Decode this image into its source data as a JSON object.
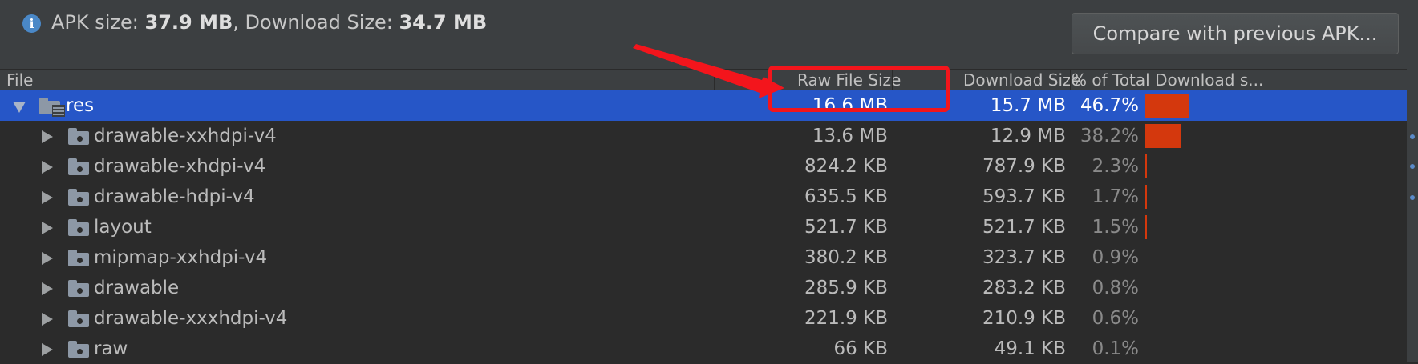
{
  "info": {
    "apk_label": "APK size: ",
    "apk_value": "37.9 MB",
    "separator": ", ",
    "download_label": "Download Size: ",
    "download_value": "34.7 MB"
  },
  "compare_button": "Compare with previous APK...",
  "columns": {
    "file": "File",
    "raw": "Raw File Size",
    "download": "Download Size",
    "percent": "% of Total Download s..."
  },
  "rows": [
    {
      "name": "res",
      "raw": "16.6 MB",
      "download": "15.7 MB",
      "percent": "46.7%",
      "pct_value": 46.7,
      "expanded": true,
      "selected": true
    },
    {
      "name": "drawable-xxhdpi-v4",
      "raw": "13.6 MB",
      "download": "12.9 MB",
      "percent": "38.2%",
      "pct_value": 38.2
    },
    {
      "name": "drawable-xhdpi-v4",
      "raw": "824.2 KB",
      "download": "787.9 KB",
      "percent": "2.3%",
      "pct_value": 2.3
    },
    {
      "name": "drawable-hdpi-v4",
      "raw": "635.5 KB",
      "download": "593.7 KB",
      "percent": "1.7%",
      "pct_value": 1.7
    },
    {
      "name": "layout",
      "raw": "521.7 KB",
      "download": "521.7 KB",
      "percent": "1.5%",
      "pct_value": 1.5
    },
    {
      "name": "mipmap-xxhdpi-v4",
      "raw": "380.2 KB",
      "download": "323.7 KB",
      "percent": "0.9%",
      "pct_value": 0.9
    },
    {
      "name": "drawable",
      "raw": "285.9 KB",
      "download": "283.2 KB",
      "percent": "0.8%",
      "pct_value": 0.8
    },
    {
      "name": "drawable-xxxhdpi-v4",
      "raw": "221.9 KB",
      "download": "210.9 KB",
      "percent": "0.6%",
      "pct_value": 0.6
    },
    {
      "name": "raw",
      "raw": "66 KB",
      "download": "49.1 KB",
      "percent": "0.1%",
      "pct_value": 0.1
    }
  ],
  "colors": {
    "selection": "#2656c7",
    "bar": "#d4380d",
    "annotation": "#f3151c"
  },
  "icons": [
    "info-icon",
    "folder-icon",
    "chevron-right-icon",
    "chevron-down-icon"
  ]
}
